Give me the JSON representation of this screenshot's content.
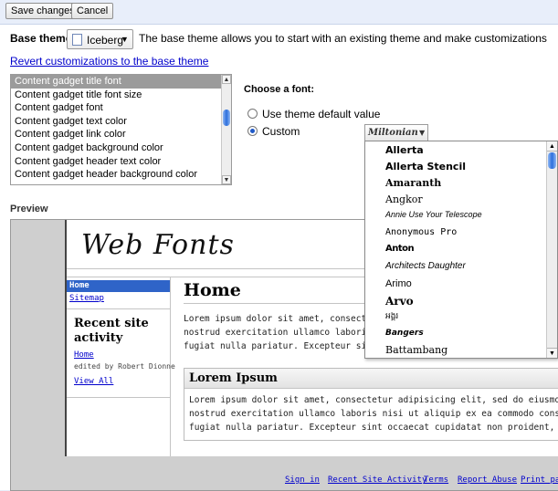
{
  "toolbar": {
    "save_label": "Save changes",
    "cancel_label": "Cancel"
  },
  "base_theme": {
    "label": "Base theme:",
    "selected": "Iceberg",
    "description": "The base theme allows you to start with an existing theme and make customizations",
    "revert_link": "Revert customizations to the base theme"
  },
  "customizations": {
    "items": [
      "Content gadget title font",
      "Content gadget title font size",
      "Content gadget font",
      "Content gadget text color",
      "Content gadget link color",
      "Content gadget background color",
      "Content gadget header text color",
      "Content gadget header background color"
    ],
    "selected_index": 0
  },
  "font_chooser": {
    "heading": "Choose a font:",
    "option_default": "Use theme default value",
    "option_custom": "Custom",
    "selected_font": "Miltonian",
    "font_options": [
      "Allerta",
      "Allerta Stencil",
      "Amaranth",
      "Angkor",
      "Annie Use Your Telescope",
      "Anonymous Pro",
      "Anton",
      "Architects Daughter",
      "Arimo",
      "Arvo",
      "អង្គរ",
      "Bangers",
      "Battambang"
    ]
  },
  "preview": {
    "label": "Preview",
    "site_title": "Web Fonts",
    "nav": [
      "Home",
      "Sitemap"
    ],
    "recent_heading": "Recent site activity",
    "recent_link": "Home",
    "recent_meta": "edited by Robert Dionne",
    "view_all": "View All",
    "page_heading": "Home",
    "body_lines": [
      "Lorem ipsum dolor sit amet, consectetur",
      "nostrud exercitation ullamco laboris ni",
      "fugiat nulla pariatur. Excepteur sint"
    ],
    "gadget_heading": "Lorem Ipsum",
    "gadget_lines": [
      "Lorem ipsum dolor sit amet, consectetur adipisicing elit, sed do eiusmod tem",
      "nostrud exercitation ullamco laboris nisi ut aliquip ex ea commodo consequat",
      "fugiat nulla pariatur. Excepteur sint occaecat cupidatat non proident, sunt"
    ],
    "footer_links": [
      "Sign in",
      "Recent Site Activity",
      "Terms",
      "Report Abuse",
      "Print pag"
    ]
  },
  "colors": {
    "accent": "#2f64c8",
    "link": "#0000cc",
    "chrome": "#e8eefa"
  },
  "icons": {
    "dropdown": "triangle-down",
    "scroll_up": "triangle-up",
    "scroll_down": "triangle-down"
  }
}
